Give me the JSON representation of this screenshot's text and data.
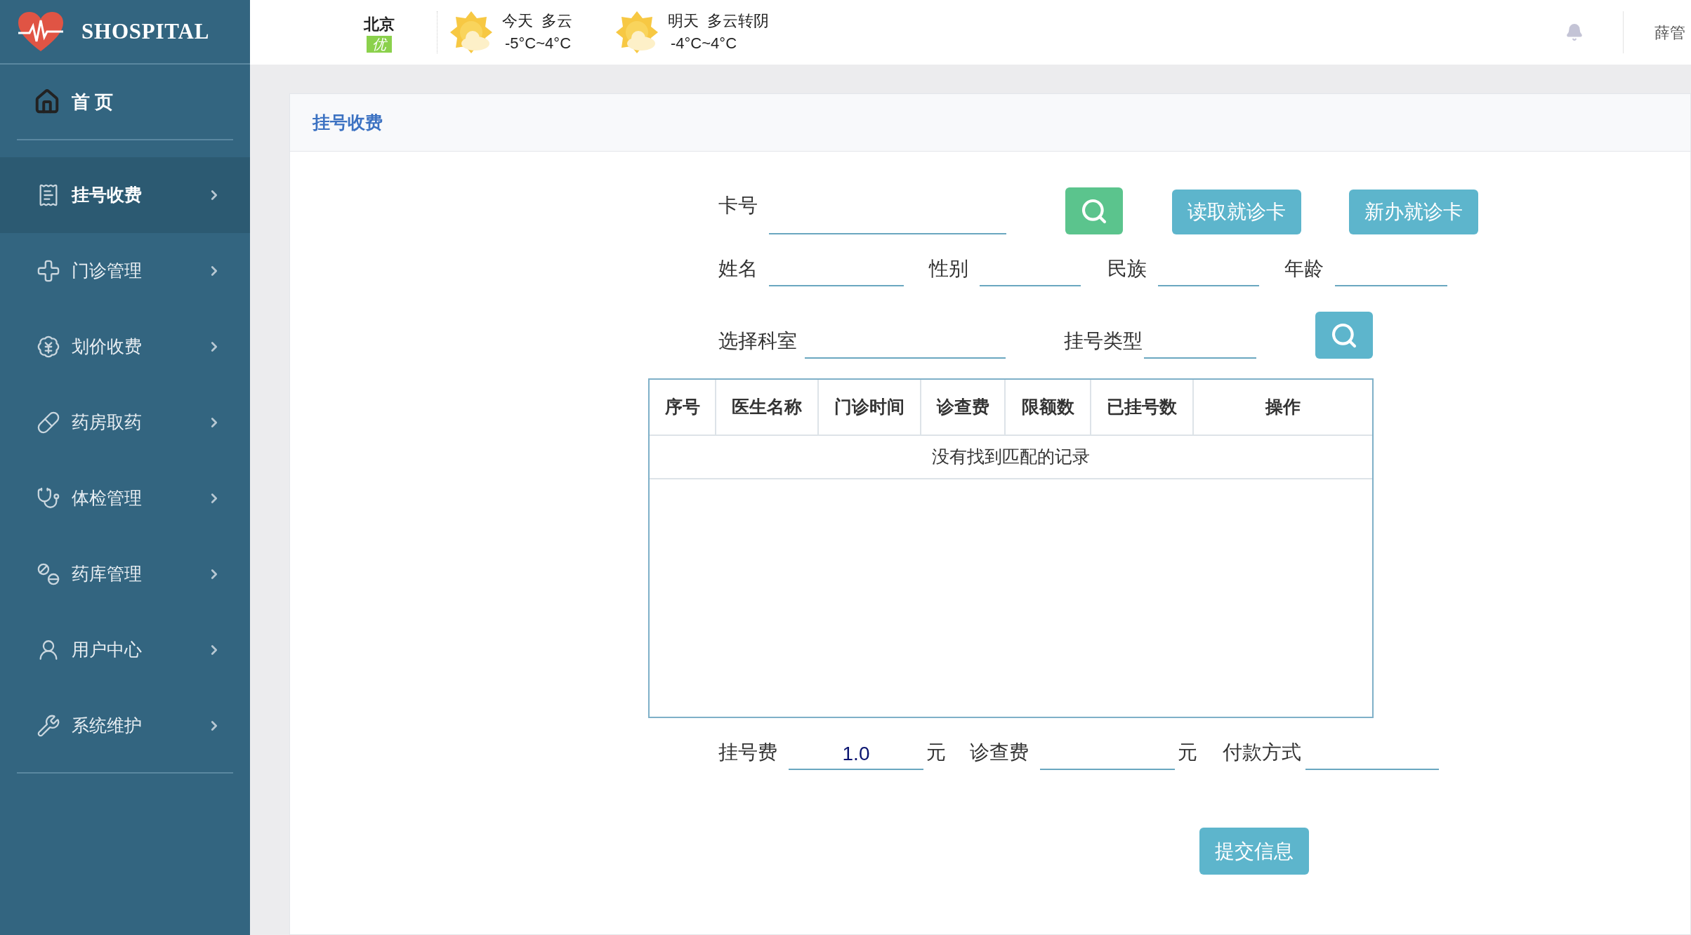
{
  "brand": {
    "name": "SHOSPITAL"
  },
  "top_bar": {
    "city": "北京",
    "air_quality": "优",
    "weather": [
      {
        "day": "今天",
        "condition": "多云",
        "temperature": "-5°C~4°C"
      },
      {
        "day": "明天",
        "condition": "多云转阴",
        "temperature": "-4°C~4°C"
      }
    ],
    "user": "薛管"
  },
  "sidebar": {
    "home": "首 页",
    "items": [
      {
        "label": "挂号收费",
        "selected": true
      },
      {
        "label": "门诊管理",
        "selected": false
      },
      {
        "label": "划价收费",
        "selected": false
      },
      {
        "label": "药房取药",
        "selected": false
      },
      {
        "label": "体检管理",
        "selected": false
      },
      {
        "label": "药库管理",
        "selected": false
      },
      {
        "label": "用户中心",
        "selected": false
      },
      {
        "label": "系统维护",
        "selected": false
      }
    ]
  },
  "panel": {
    "title": "挂号收费"
  },
  "form": {
    "card_number": {
      "label": "卡号"
    },
    "read_card_button": "读取就诊卡",
    "new_card_button": "新办就诊卡",
    "patient_fields": [
      {
        "label": "姓名"
      },
      {
        "label": "性别"
      },
      {
        "label": "民族"
      },
      {
        "label": "年龄"
      }
    ],
    "department": {
      "label": "选择科室"
    },
    "registration_type": {
      "label": "挂号类型"
    }
  },
  "table": {
    "columns": [
      "序号",
      "医生名称",
      "门诊时间",
      "诊查费",
      "限额数",
      "已挂号数",
      "操作"
    ],
    "empty_message": "没有找到匹配的记录"
  },
  "fees": {
    "registration_fee": {
      "label": "挂号费",
      "value": "1.0",
      "unit": "元"
    },
    "exam_fee": {
      "label": "诊查费",
      "unit": "元"
    },
    "payment_method": {
      "label": "付款方式"
    }
  },
  "submit_button": "提交信息"
}
